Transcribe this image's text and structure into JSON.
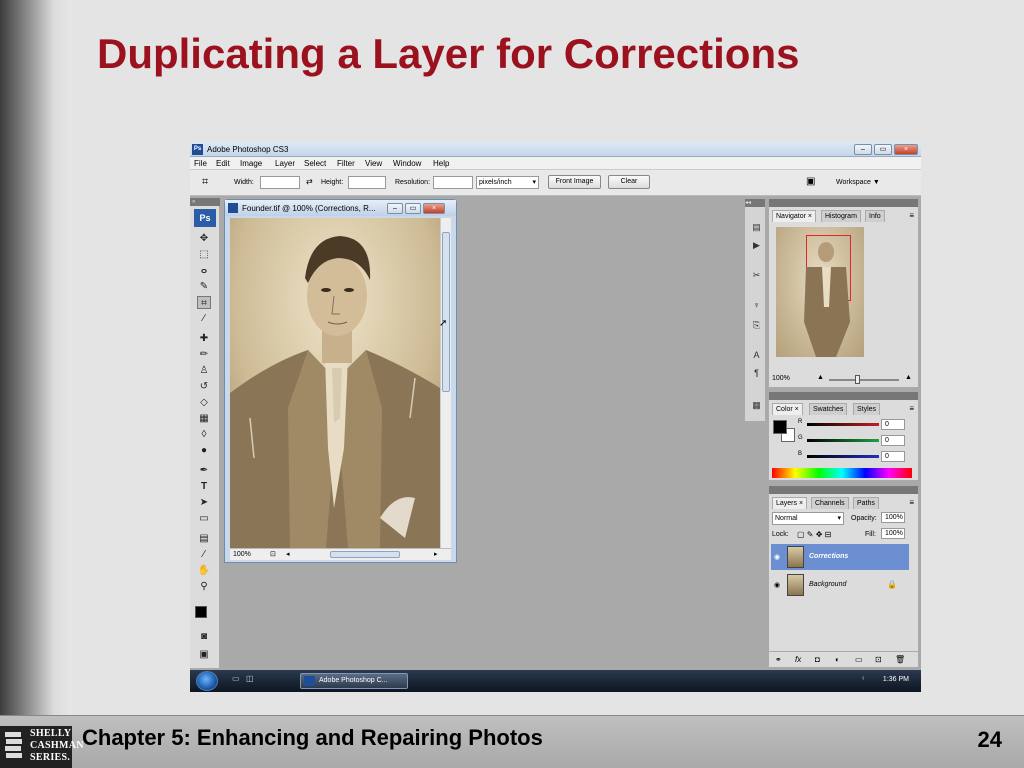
{
  "slide": {
    "title": "Duplicating a Layer for Corrections",
    "footer": "Chapter 5: Enhancing and Repairing Photos",
    "page_number": "24",
    "logo_lines": [
      "SHELLY",
      "CASHMAN",
      "SERIES."
    ]
  },
  "app": {
    "title": "Adobe Photoshop CS3",
    "icon_label": "Ps",
    "window_buttons": [
      "minimize",
      "maximize",
      "close"
    ]
  },
  "menu": [
    "File",
    "Edit",
    "Image",
    "Layer",
    "Select",
    "Filter",
    "View",
    "Window",
    "Help"
  ],
  "options": {
    "width_label": "Width:",
    "height_label": "Height:",
    "resolution_label": "Resolution:",
    "units": "pixels/inch",
    "front_image": "Front Image",
    "clear": "Clear",
    "workspace": "Workspace ▼"
  },
  "toolbox": {
    "logo": "Ps",
    "tools": [
      "move-icon",
      "marquee-icon",
      "lasso-icon",
      "quick-selection-icon",
      "crop-icon",
      "slice-icon",
      "healing-brush-icon",
      "brush-icon",
      "clone-stamp-icon",
      "history-brush-icon",
      "eraser-icon",
      "gradient-icon",
      "blur-icon",
      "dodge-icon",
      "pen-icon",
      "type-icon",
      "path-selection-icon",
      "shape-icon",
      "notes-icon",
      "eyedropper-icon",
      "hand-icon",
      "zoom-icon"
    ]
  },
  "document": {
    "title": "Founder.tif @ 100% (Corrections, R...",
    "zoom": "100%"
  },
  "navigator": {
    "tabs": [
      "Navigator ×",
      "Histogram",
      "Info"
    ],
    "zoom": "100%"
  },
  "color": {
    "tabs": [
      "Color ×",
      "Swatches",
      "Styles"
    ],
    "channels": [
      {
        "label": "R",
        "value": "0",
        "color": "#cc2020"
      },
      {
        "label": "G",
        "value": "0",
        "color": "#20a040"
      },
      {
        "label": "B",
        "value": "0",
        "color": "#2030c0"
      }
    ]
  },
  "layers": {
    "tabs": [
      "Layers ×",
      "Channels",
      "Paths"
    ],
    "blend_mode": "Normal",
    "opacity_label": "Opacity:",
    "opacity": "100%",
    "lock_label": "Lock:",
    "fill_label": "Fill:",
    "fill": "100%",
    "items": [
      {
        "name": "Corrections",
        "selected": true
      },
      {
        "name": "Background",
        "selected": false
      }
    ]
  },
  "taskbar": {
    "app_button": "Adobe Photoshop C...",
    "time": "1:36 PM"
  },
  "colors": {
    "title_red": "#9b111e",
    "selected_layer": "#6b8fd1"
  }
}
